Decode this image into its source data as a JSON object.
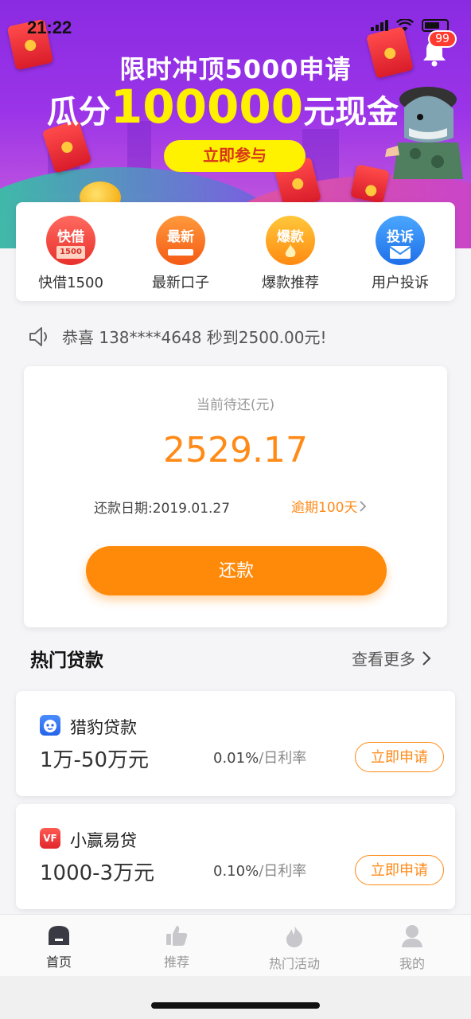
{
  "status_bar": {
    "time": "21:22"
  },
  "notifications": {
    "badge": "99"
  },
  "banner": {
    "line1": "限时冲顶5000申请",
    "line2_prefix": "瓜分",
    "line2_amount": "100000",
    "line2_suffix": "元现金",
    "button": "立即参与"
  },
  "quick_menu": [
    {
      "icon": "快借",
      "sub": "1500",
      "label": "快借1500",
      "color": "#f0413a"
    },
    {
      "icon": "最新",
      "sub": "",
      "label": "最新口子",
      "color": "#ff7a1f"
    },
    {
      "icon": "爆款",
      "sub": "",
      "label": "爆款推荐",
      "color": "#ffa81a"
    },
    {
      "icon": "投诉",
      "sub": "",
      "label": "用户投诉",
      "color": "#2f8cf5"
    }
  ],
  "notice": {
    "text": "恭喜 138****4648 秒到2500.00元!"
  },
  "repay": {
    "label": "当前待还(元)",
    "amount": "2529.17",
    "date": "还款日期:2019.01.27",
    "overdue": "逾期100天",
    "button": "还款"
  },
  "hot": {
    "title": "热门贷款",
    "more": "查看更多",
    "loans": [
      {
        "name": "猎豹贷款",
        "range": "1万-50万元",
        "rate": "0.01%",
        "rate_unit": "/日利率",
        "button": "立即申请",
        "logo_color": "#2f7cf6"
      },
      {
        "name": "小赢易贷",
        "range": "1000-3万元",
        "rate": "0.10%",
        "rate_unit": "/日利率",
        "button": "立即申请",
        "logo_text": "VF",
        "logo_color": "#f0413a"
      }
    ]
  },
  "tabs": [
    {
      "label": "首页",
      "icon": "home-icon",
      "active": true
    },
    {
      "label": "推荐",
      "icon": "thumbs-up-icon",
      "active": false
    },
    {
      "label": "热门活动",
      "icon": "flame-icon",
      "active": false
    },
    {
      "label": "我的",
      "icon": "user-icon",
      "active": false
    }
  ]
}
